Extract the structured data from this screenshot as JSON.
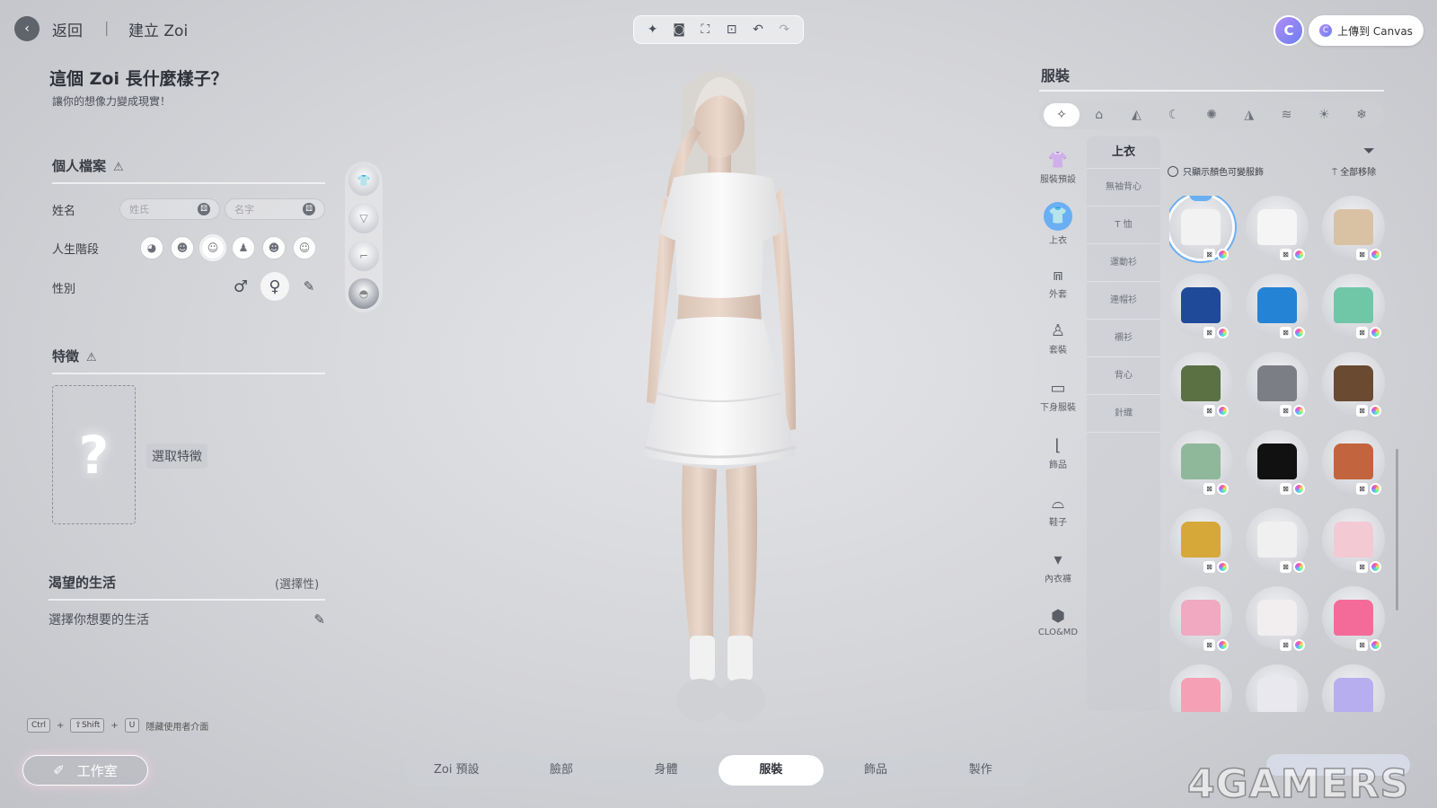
{
  "header": {
    "back_label": "返回",
    "separator": "|",
    "page_title": "建立 Zoi",
    "toolbar_icons": [
      "sparkle-icon",
      "camera-icon",
      "focus-icon",
      "face-focus-icon",
      "undo-icon",
      "redo-icon"
    ],
    "canvas_avatar_letter": "C",
    "canvas_button_label": "上傳到 Canvas"
  },
  "intro": {
    "headline": "這個 Zoi 長什麼樣子？",
    "subline": "讓你的想像力變成現實！"
  },
  "profile": {
    "title": "個人檔案",
    "name_label": "姓名",
    "last_name_placeholder": "姓氏",
    "first_name_placeholder": "名字",
    "life_stage_label": "人生階段",
    "life_stages": [
      "infant",
      "child",
      "teen",
      "young-adult",
      "adult",
      "elder"
    ],
    "life_stage_selected": "teen",
    "gender_label": "性別",
    "gender_selected": "female"
  },
  "traits": {
    "title": "特徵",
    "placeholder_glyph": "?",
    "choose_label": "選取特徵"
  },
  "aspiration": {
    "title": "渴望的生活",
    "optional": "(選擇性)",
    "choose_label": "選擇你想要的生活"
  },
  "shortcut": {
    "keys": [
      "Ctrl",
      "⇧Shift",
      "U"
    ],
    "plus": "+",
    "description": "隱藏使用者介面"
  },
  "studio_button": "工作室",
  "bottom_nav": {
    "tabs": [
      "Zoi 預設",
      "臉部",
      "身體",
      "服裝",
      "飾品",
      "製作"
    ],
    "active": "服裝"
  },
  "right_panel": {
    "title": "服裝",
    "category_icons": [
      "all-icon",
      "gift-icon",
      "formal-icon",
      "sleep-icon",
      "party-icon",
      "athletic-icon",
      "swim-icon",
      "summer-icon",
      "winter-icon"
    ],
    "side_categories": [
      "服裝預設",
      "上衣",
      "外套",
      "套裝",
      "下身服裝",
      "飾品",
      "鞋子",
      "內衣褲",
      "CLO&MD"
    ],
    "side_selected": "上衣",
    "sub_categories": [
      "上衣",
      "無袖背心",
      "T 恤",
      "運動衫",
      "連帽衫",
      "襯衫",
      "背心",
      "針織"
    ],
    "color_toggle_label": "只顯示顏色可變服飾",
    "remove_all_label": "全部移除",
    "items": [
      {
        "color": "#f2f2f2",
        "selected": true
      },
      {
        "color": "#f5f5f5"
      },
      {
        "color": "#d9c2a3"
      },
      {
        "color": "#1f4a9a"
      },
      {
        "color": "#2583d6"
      },
      {
        "color": "#6fc7a8"
      },
      {
        "color": "#5b7043"
      },
      {
        "color": "#7b7e85"
      },
      {
        "color": "#6a4a30"
      },
      {
        "color": "#8fb89a"
      },
      {
        "color": "#111111"
      },
      {
        "color": "#c2643d"
      },
      {
        "color": "#d6a83a"
      },
      {
        "color": "#f0f0f0"
      },
      {
        "color": "#f3c9d4"
      },
      {
        "color": "#f0a9c0"
      },
      {
        "color": "#f2eef0"
      },
      {
        "color": "#f46b99"
      },
      {
        "color": "#f5a0b4"
      },
      {
        "color": "#e8e8ee"
      },
      {
        "color": "#b7aef0"
      }
    ]
  },
  "watermark": "4GAMERS",
  "colors": {
    "accent": "#6aaef3",
    "canvas_brand": "#8a7ff2"
  }
}
